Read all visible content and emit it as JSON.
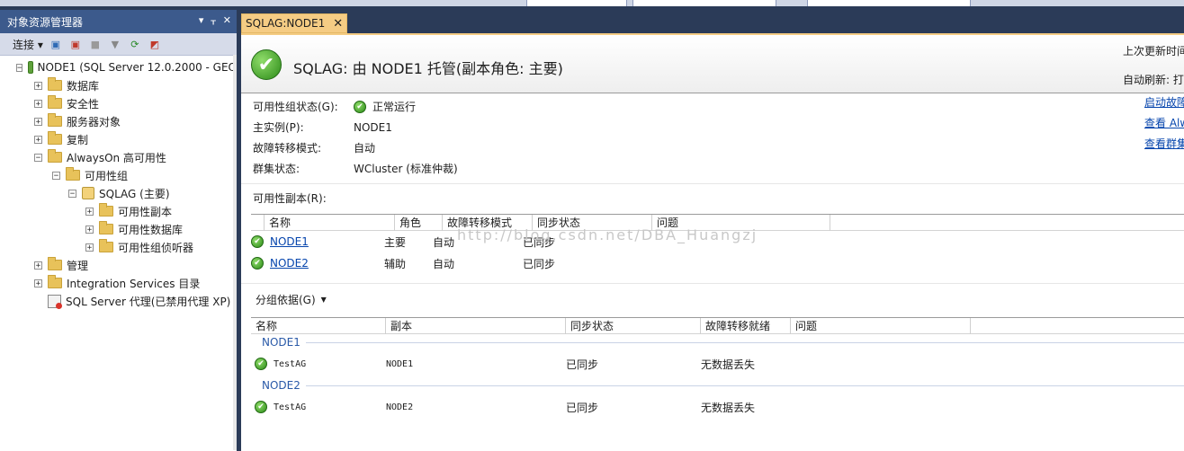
{
  "object_explorer": {
    "title": "对象资源管理器",
    "title_controls": [
      "▾",
      "ᚁ",
      "✕"
    ],
    "connect_label": "连接",
    "tree": [
      {
        "label": "NODE1 (SQL Server 12.0.2000 - GEO",
        "level": 0,
        "expander": "⊟",
        "icon": "server-icon"
      },
      {
        "label": "数据库",
        "level": 1,
        "expander": "⊞",
        "icon": "folder-icon"
      },
      {
        "label": "安全性",
        "level": 1,
        "expander": "⊞",
        "icon": "folder-icon"
      },
      {
        "label": "服务器对象",
        "level": 1,
        "expander": "⊞",
        "icon": "folder-icon"
      },
      {
        "label": "复制",
        "level": 1,
        "expander": "⊞",
        "icon": "folder-icon"
      },
      {
        "label": "AlwaysOn 高可用性",
        "level": 1,
        "expander": "⊟",
        "icon": "folder-icon"
      },
      {
        "label": "可用性组",
        "level": 2,
        "expander": "⊟",
        "icon": "folder-icon"
      },
      {
        "label": "SQLAG (主要)",
        "level": 3,
        "expander": "⊟",
        "icon": "availability-group-icon"
      },
      {
        "label": "可用性副本",
        "level": 4,
        "expander": "⊞",
        "icon": "folder-icon"
      },
      {
        "label": "可用性数据库",
        "level": 4,
        "expander": "⊞",
        "icon": "folder-icon"
      },
      {
        "label": "可用性组侦听器",
        "level": 4,
        "expander": "⊞",
        "icon": "folder-icon"
      },
      {
        "label": "管理",
        "level": 1,
        "expander": "⊞",
        "icon": "folder-icon"
      },
      {
        "label": "Integration Services 目录",
        "level": 1,
        "expander": "⊞",
        "icon": "folder-icon"
      },
      {
        "label": "SQL Server 代理(已禁用代理 XP)",
        "level": 1,
        "expander": "",
        "icon": "agent-disabled-icon"
      }
    ]
  },
  "tab": {
    "label": "SQLAG:NODE1",
    "close": "✕"
  },
  "header": {
    "title": "SQLAG: 由 NODE1 托管(副本角色: 主要)",
    "last_updated": "上次更新时间",
    "auto_refresh": "自动刷新: 打"
  },
  "links": [
    "启动故障",
    "查看 Alw",
    "查看群集"
  ],
  "properties": [
    {
      "label": "可用性组状态(G):",
      "value": "正常运行",
      "icon": true
    },
    {
      "label": "主实例(P):",
      "value": "NODE1",
      "icon": false
    },
    {
      "label": "故障转移模式:",
      "value": "自动",
      "icon": false
    },
    {
      "label": "群集状态:",
      "value": "WCluster (标准仲裁)",
      "icon": false
    }
  ],
  "replicas_section": {
    "title": "可用性副本(R):",
    "columns": [
      "名称",
      "角色",
      "故障转移模式",
      "同步状态",
      "问题"
    ],
    "rows": [
      {
        "name": "NODE1",
        "role": "主要",
        "failover": "自动",
        "sync": "已同步",
        "issue": ""
      },
      {
        "name": "NODE2",
        "role": "辅助",
        "failover": "自动",
        "sync": "已同步",
        "issue": ""
      }
    ]
  },
  "group_by": {
    "label": "分组依据(G)",
    "arrow": "▼"
  },
  "databases_section": {
    "columns": [
      "名称",
      "副本",
      "同步状态",
      "故障转移就绪",
      "问题"
    ],
    "groups": [
      {
        "name": "NODE1",
        "rows": [
          {
            "name": "TestAG",
            "replica": "NODE1",
            "sync": "已同步",
            "ready": "无数据丢失",
            "issue": ""
          }
        ]
      },
      {
        "name": "NODE2",
        "rows": [
          {
            "name": "TestAG",
            "replica": "NODE2",
            "sync": "已同步",
            "ready": "无数据丢失",
            "issue": ""
          }
        ]
      }
    ]
  },
  "watermark": "http://blog.csdn.net/DBA_Huangzj"
}
